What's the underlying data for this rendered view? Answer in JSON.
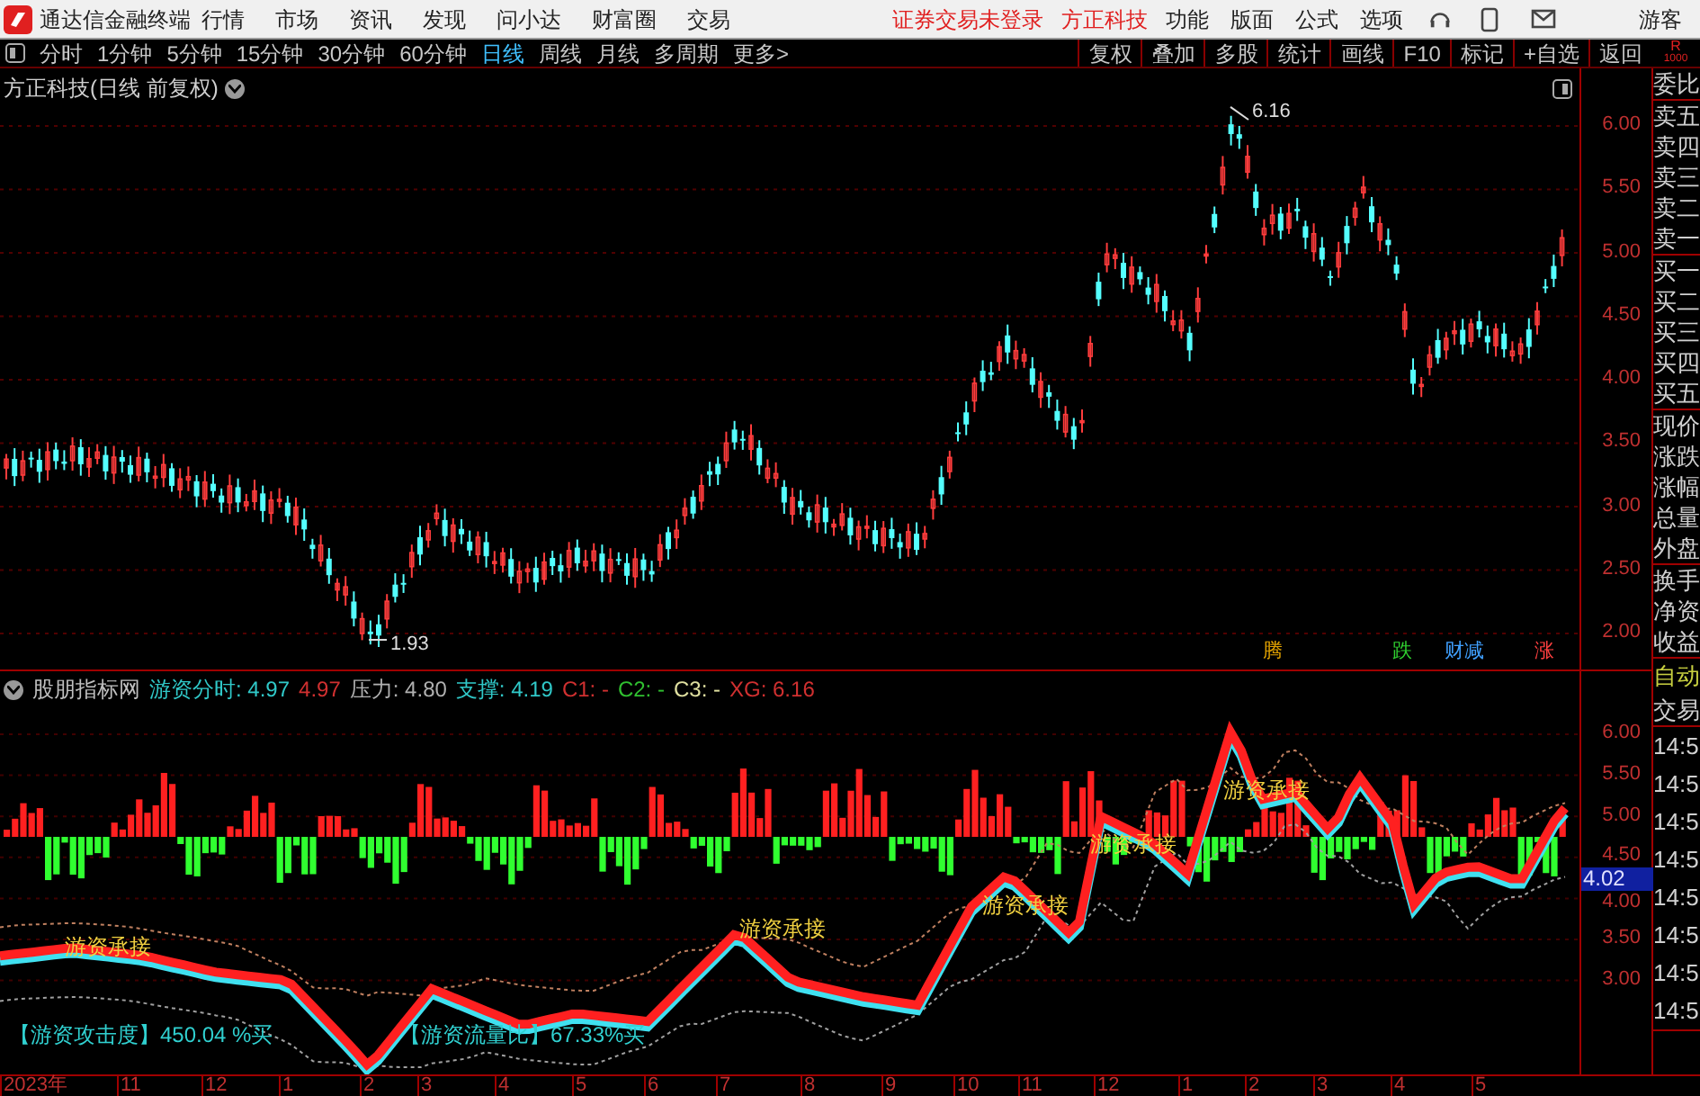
{
  "app_bar": {
    "title": "通达信金融终端",
    "menu": [
      "行情",
      "市场",
      "资讯",
      "发现",
      "问小达",
      "财富圈",
      "交易"
    ],
    "notices": [
      "证券交易未登录",
      "方正科技"
    ],
    "right_menu": [
      "功能",
      "版面",
      "公式",
      "选项"
    ],
    "user": "游客"
  },
  "toolbar": {
    "periods": [
      {
        "label": "分时",
        "selected": false
      },
      {
        "label": "1分钟",
        "selected": false
      },
      {
        "label": "5分钟",
        "selected": false
      },
      {
        "label": "15分钟",
        "selected": false
      },
      {
        "label": "30分钟",
        "selected": false
      },
      {
        "label": "60分钟",
        "selected": false
      },
      {
        "label": "日线",
        "selected": true
      },
      {
        "label": "周线",
        "selected": false
      },
      {
        "label": "月线",
        "selected": false
      },
      {
        "label": "多周期",
        "selected": false
      },
      {
        "label": "更多>",
        "selected": false
      }
    ],
    "actions": [
      "复权",
      "叠加",
      "多股",
      "统计",
      "画线",
      "F10",
      "标记",
      "+自选",
      "返回"
    ]
  },
  "main_chart": {
    "title": "方正科技(日线 前复权)",
    "y_ticks": [
      "6.00",
      "5.50",
      "5.00",
      "4.50",
      "4.00",
      "3.50",
      "3.00",
      "2.50",
      "2.00"
    ],
    "high_label": "6.16",
    "low_label": "1.93",
    "signals": [
      {
        "label": "腾",
        "color": "#e0a000"
      },
      {
        "label": "跌",
        "color": "#30d030"
      },
      {
        "label": "财减",
        "color": "#40a0ff"
      },
      {
        "label": "涨",
        "color": "#ff4040"
      }
    ]
  },
  "indicator": {
    "name": "股朋指标网",
    "values": [
      {
        "text": "游资分时: 4.97",
        "color": "#30c8c8"
      },
      {
        "text": "4.97",
        "color": "#d03030"
      },
      {
        "text": "压力: 4.80",
        "color": "#b0b0b0"
      },
      {
        "text": "支撑: 4.19",
        "color": "#30c8c8"
      },
      {
        "text": "C1: -",
        "color": "#d03030"
      },
      {
        "text": "C2: -",
        "color": "#30c030"
      },
      {
        "text": "C3: -",
        "color": "#e0e0a0"
      },
      {
        "text": "XG: 6.16",
        "color": "#d03030"
      }
    ],
    "y_ticks": [
      "6.00",
      "5.50",
      "5.00",
      "4.50",
      "4.00",
      "3.50",
      "3.00"
    ],
    "current": "4.02",
    "labels": [
      "游资承接",
      "游资承接",
      "游资承接",
      "游资承接",
      "游资承接"
    ],
    "notes": [
      "【游资攻击度】450.04 %买",
      "【游资流量比】67.33%买"
    ]
  },
  "x_axis": [
    "2023年",
    "11",
    "12",
    "1",
    "2",
    "3",
    "4",
    "5",
    "6",
    "7",
    "8",
    "9",
    "10",
    "11",
    "12",
    "1",
    "2",
    "3",
    "4",
    "5"
  ],
  "quote_panel": {
    "header": [
      "R",
      "1000"
    ],
    "groups": [
      [
        {
          "label": "委比",
          "kind": "field"
        }
      ],
      [
        {
          "label": "卖五",
          "kind": "field"
        },
        {
          "label": "卖四",
          "kind": "field"
        },
        {
          "label": "卖三",
          "kind": "field"
        },
        {
          "label": "卖二",
          "kind": "field"
        },
        {
          "label": "卖一",
          "kind": "field"
        }
      ],
      [
        {
          "label": "买一",
          "kind": "field"
        },
        {
          "label": "买二",
          "kind": "field"
        },
        {
          "label": "买三",
          "kind": "field"
        },
        {
          "label": "买四",
          "kind": "field"
        },
        {
          "label": "买五",
          "kind": "field"
        }
      ],
      [
        {
          "label": "现价",
          "kind": "field"
        },
        {
          "label": "涨跌",
          "kind": "field"
        },
        {
          "label": "涨幅",
          "kind": "field"
        },
        {
          "label": "总量",
          "kind": "field"
        },
        {
          "label": "外盘",
          "kind": "field"
        }
      ],
      [
        {
          "label": "换手",
          "kind": "field"
        },
        {
          "label": "净资",
          "kind": "field"
        },
        {
          "label": "收益",
          "kind": "field"
        }
      ],
      [
        {
          "label": "自动",
          "kind": "toggle"
        },
        {
          "label": "交易",
          "kind": "field"
        }
      ],
      [
        {
          "label": "14:5",
          "kind": "time"
        },
        {
          "label": "14:5",
          "kind": "time"
        },
        {
          "label": "14:5",
          "kind": "time"
        },
        {
          "label": "14:5",
          "kind": "time"
        },
        {
          "label": "14:5",
          "kind": "time"
        },
        {
          "label": "14:5",
          "kind": "time"
        },
        {
          "label": "14:5",
          "kind": "time"
        },
        {
          "label": "14:5",
          "kind": "time"
        }
      ]
    ]
  }
}
